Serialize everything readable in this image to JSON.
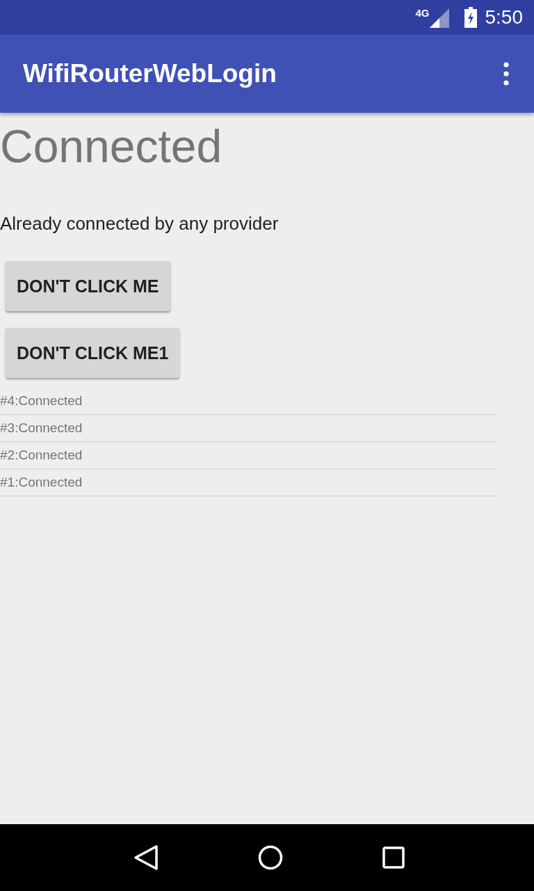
{
  "status_bar": {
    "network": "4G",
    "time": "5:50"
  },
  "app_bar": {
    "title": "WifiRouterWebLogin"
  },
  "heading": "Connected",
  "message": "Already connected by any provider",
  "buttons": [
    "DON'T CLICK ME",
    "DON'T CLICK ME1"
  ],
  "log": [
    "#4:Connected",
    "#3:Connected",
    "#2:Connected",
    "#1:Connected"
  ]
}
